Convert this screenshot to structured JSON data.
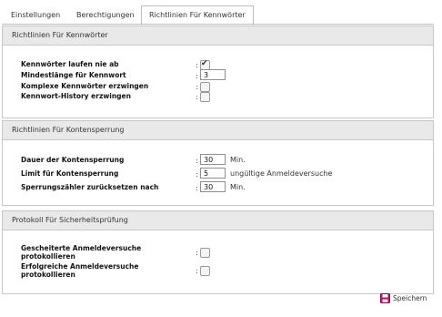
{
  "tabs": [
    {
      "label": "Einstellungen"
    },
    {
      "label": "Berechtigungen"
    },
    {
      "label": "Richtlinien Für Kennwörter"
    }
  ],
  "sections": {
    "passwords": {
      "title": "Richtlinien Für Kennwörter",
      "never_expire": {
        "label": "Kennwörter laufen nie ab",
        "checked": true
      },
      "min_length": {
        "label": "Mindestlänge für Kennwort",
        "value": "3"
      },
      "complex": {
        "label": "Komplexe Kennwörter erzwingen",
        "checked": false
      },
      "history": {
        "label": "Kennwort-History erzwingen",
        "checked": false
      }
    },
    "lockout": {
      "title": "Richtlinien Für Kontensperrung",
      "duration": {
        "label": "Dauer der Kontensperrung",
        "value": "30",
        "unit": "Min."
      },
      "limit": {
        "label": "Limit für Kontensperrung",
        "value": "5",
        "unit": "ungültige Anmeldeversuche"
      },
      "reset": {
        "label": "Sperrungszähler zurücksetzen nach",
        "value": "30",
        "unit": "Min."
      }
    },
    "audit": {
      "title": "Protokoll Für Sicherheitsprüfung",
      "failed": {
        "label": "Gescheiterte Anmeldeversuche protokollieren",
        "checked": false
      },
      "success": {
        "label": "Erfolgreiche Anmeldeversuche protokollieren",
        "checked": false
      }
    }
  },
  "colon": ":",
  "save_label": "Speichern",
  "colors": {
    "header_bg": "#e9e9e9",
    "border": "#c7c7c7",
    "save_icon": "#b0206a"
  }
}
